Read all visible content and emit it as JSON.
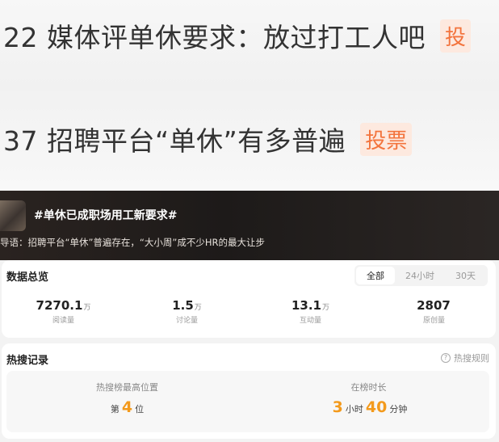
{
  "rank_rows": [
    {
      "text": "22 媒体评单休要求：放过打工人吧",
      "tag": "投"
    },
    {
      "text": "37 招聘平台“单休”有多普遍",
      "tag": "投票"
    }
  ],
  "topic": {
    "title": "#单休已成职场用工新要求#",
    "guide": "导语：招聘平台“单休”普遍存在，“大小周”成不少HR的最大让步"
  },
  "overview": {
    "title": "数据总览",
    "tabs": [
      "全部",
      "24小时",
      "30天"
    ],
    "stats": [
      {
        "value": "7270.1",
        "unit": "万",
        "label": "阅读量"
      },
      {
        "value": "1.5",
        "unit": "万",
        "label": "讨论量"
      },
      {
        "value": "13.1",
        "unit": "万",
        "label": "互动量"
      },
      {
        "value": "2807",
        "unit": "",
        "label": "原创量"
      }
    ]
  },
  "hot": {
    "title": "热搜记录",
    "rules_label": "热搜规则",
    "best_position_label": "热搜榜最高位置",
    "best_position_prefix": "第",
    "best_position_value": "4",
    "best_position_suffix": "位",
    "duration_label": "在榜时长",
    "hours_value": "3",
    "hours_unit": "小时",
    "minutes_value": "40",
    "minutes_unit": "分钟"
  },
  "colors": {
    "accent_orange": "#f39a1c",
    "vote_tag": "#f3743d"
  }
}
